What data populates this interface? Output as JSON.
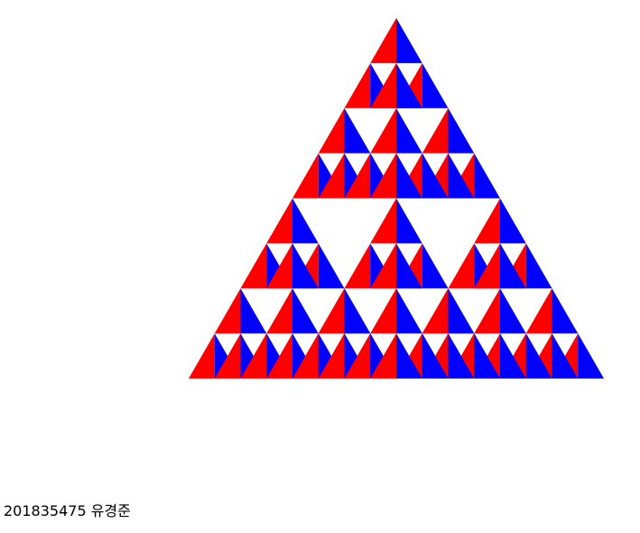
{
  "canvas": {
    "title": "",
    "subdivision_depth": 3,
    "colors": {
      "left_face": "#ff0000",
      "right_face": "#0000ff",
      "bottom_face": "#00ff00",
      "background": "#ffffff"
    }
  },
  "caption": {
    "text": "201835475 유경준"
  }
}
